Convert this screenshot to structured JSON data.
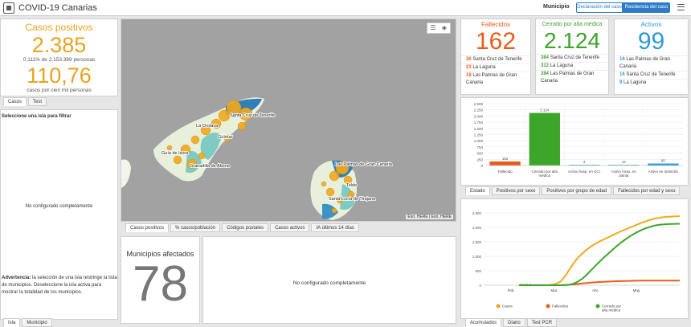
{
  "header": {
    "title": "COVID-19 Canarias",
    "municipio_label": "Municipio",
    "toggle": [
      "Declaración del caso",
      "Residencia del caso"
    ]
  },
  "positivos": {
    "title": "Casos positivos",
    "value": "2.385",
    "pct_line": "0,111% de 2.153.389 personas",
    "rate": "110,76",
    "rate_label": "casos por cien mil personas",
    "tabs": [
      "Casos",
      "Test"
    ]
  },
  "filter": {
    "title": "Seleccione una isla para filtrar",
    "empty": "No configurado completamente",
    "warning_bold": "Advertencia:",
    "warning_text": " la selección de una isla restringe la lista de municipios. Deseleccione la isla activa para mostrar la totalidad de los municipios.",
    "tabs": [
      "Isla",
      "Municipio"
    ]
  },
  "map": {
    "labels": [
      "Santa Cruz de Tenerife",
      "La Orotava",
      "Güímar",
      "Guía de Isora",
      "Granadilla de Abona",
      "Las Palmas de Gran Canaria",
      "Telde",
      "Santa Lucía de Tirajana"
    ],
    "attribution": "Esri, HERE | Esri, HERE",
    "tabs": [
      "Casos positivos",
      "% casos/población",
      "Códigos postales",
      "Casos activos",
      "IA últimos 14 días"
    ]
  },
  "municipios": {
    "title": "Municipios afectados",
    "value": "78",
    "empty": "No configurado completamente"
  },
  "fallecidos": {
    "title": "Fallecidos",
    "value": "162",
    "rows": [
      {
        "n": "26",
        "name": "Santa Cruz de Tenerife"
      },
      {
        "n": "23",
        "name": "La Laguna"
      },
      {
        "n": "18",
        "name": "Las Palmas de Gran Canaria"
      }
    ]
  },
  "cerrado": {
    "title": "Cerrado por alta médica",
    "value": "2.124",
    "rows": [
      {
        "n": "384",
        "name": "Santa Cruz de Tenerife"
      },
      {
        "n": "312",
        "name": "La Laguna"
      },
      {
        "n": "284",
        "name": "Las Palmas de Gran Canaria"
      }
    ]
  },
  "activos": {
    "title": "Activos",
    "value": "99",
    "rows": [
      {
        "n": "16",
        "name": "Las Palmas de Gran Canaria"
      },
      {
        "n": "16",
        "name": "Santa Cruz de Tenerife"
      },
      {
        "n": "9",
        "name": "La Laguna"
      }
    ]
  },
  "bar_tabs": [
    "Estado",
    "Positivos por sexo",
    "Positivos por grupo de edad",
    "Fallecidos por edad y sexo"
  ],
  "line_tabs": [
    "Acumulados",
    "Diario",
    "Test PCR"
  ],
  "chart_data": [
    {
      "type": "bar",
      "categories": [
        "Fallecido",
        "Cerrado por alta médica",
        "Activo hosp. en UCI",
        "Activo hosp. en planta",
        "Activo en domicilio"
      ],
      "values": [
        162,
        2124,
        3,
        16,
        80
      ],
      "ylim": [
        0,
        2500
      ],
      "yticks": [
        "0",
        "250",
        "500",
        "750",
        "1.000",
        "1.250",
        "1.500",
        "1.750",
        "2.000",
        "2.250",
        "2.500"
      ],
      "value_labels": [
        "162",
        "2.124",
        "3",
        "16",
        "80"
      ],
      "colors": [
        "#e85d1c",
        "#3ea52b",
        "#2d9bd6",
        "#2d9bd6",
        "#2d9bd6"
      ]
    },
    {
      "type": "line",
      "x_ticks": [
        "Feb.",
        "Mar.",
        "Abr.",
        "May."
      ],
      "yticks": [
        "0",
        "500",
        "1.000",
        "1.500",
        "2.000",
        "2.500"
      ],
      "ylim": [
        0,
        2500
      ],
      "series": [
        {
          "name": "Casos",
          "color": "#f2a91c",
          "values": [
            0,
            0,
            0,
            0,
            0,
            0,
            0,
            5,
            20,
            60,
            150,
            330,
            560,
            780,
            960,
            1100,
            1230,
            1340,
            1430,
            1510,
            1580,
            1650,
            1720,
            1790,
            1860,
            1920,
            1980,
            2040,
            2100,
            2160,
            2210,
            2260,
            2300,
            2330,
            2350,
            2365,
            2375,
            2380,
            2385
          ]
        },
        {
          "name": "Fallecidos",
          "color": "#e85d1c",
          "values": [
            0,
            0,
            0,
            0,
            0,
            0,
            0,
            0,
            0,
            0,
            2,
            8,
            18,
            30,
            45,
            60,
            75,
            90,
            100,
            110,
            118,
            125,
            132,
            138,
            143,
            147,
            150,
            153,
            155,
            157,
            158,
            159,
            160,
            160,
            161,
            161,
            162,
            162,
            162
          ]
        },
        {
          "name": "Cerrado por alta médica",
          "color": "#3ea52b",
          "values": [
            0,
            0,
            0,
            0,
            0,
            0,
            0,
            0,
            0,
            0,
            0,
            5,
            20,
            60,
            130,
            230,
            360,
            510,
            660,
            810,
            950,
            1080,
            1210,
            1340,
            1460,
            1570,
            1670,
            1760,
            1840,
            1910,
            1970,
            2020,
            2060,
            2085,
            2100,
            2110,
            2117,
            2121,
            2124
          ]
        }
      ]
    }
  ]
}
